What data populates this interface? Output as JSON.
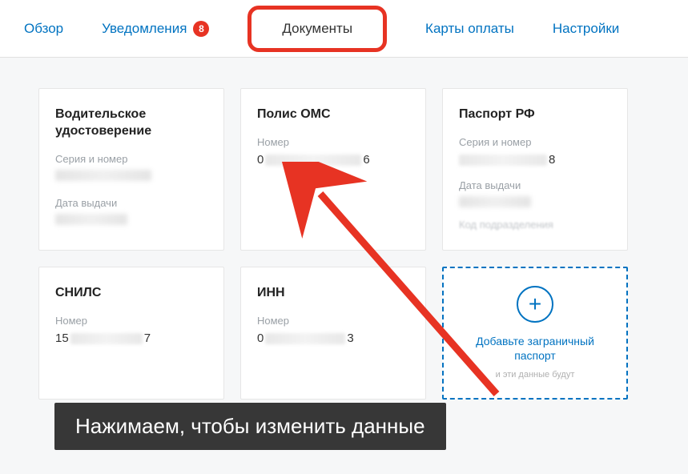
{
  "tabs": {
    "overview": "Обзор",
    "notifications": "Уведомления",
    "notifications_badge": "8",
    "documents": "Документы",
    "payment_cards": "Карты оплаты",
    "settings": "Настройки"
  },
  "cards": {
    "driver_license": {
      "title": "Водительское удостоверение",
      "series_label": "Серия и номер",
      "date_label": "Дата выдачи"
    },
    "oms": {
      "title": "Полис ОМС",
      "number_label": "Номер",
      "number_start": "0",
      "number_end": "6"
    },
    "passport_rf": {
      "title": "Паспорт РФ",
      "series_label": "Серия и номер",
      "series_end": "8",
      "date_label": "Дата выдачи",
      "dept_label": "Код подразделения"
    },
    "snils": {
      "title": "СНИЛС",
      "number_label": "Номер",
      "number_start": "15",
      "number_end": "7"
    },
    "inn": {
      "title": "ИНН",
      "number_label": "Номер",
      "number_start": "0",
      "number_end": "3"
    },
    "add_intl_passport": {
      "link": "Добавьте заграничный паспорт",
      "sub": "и эти данные будут"
    }
  },
  "caption": "Нажимаем, чтобы изменить данные"
}
